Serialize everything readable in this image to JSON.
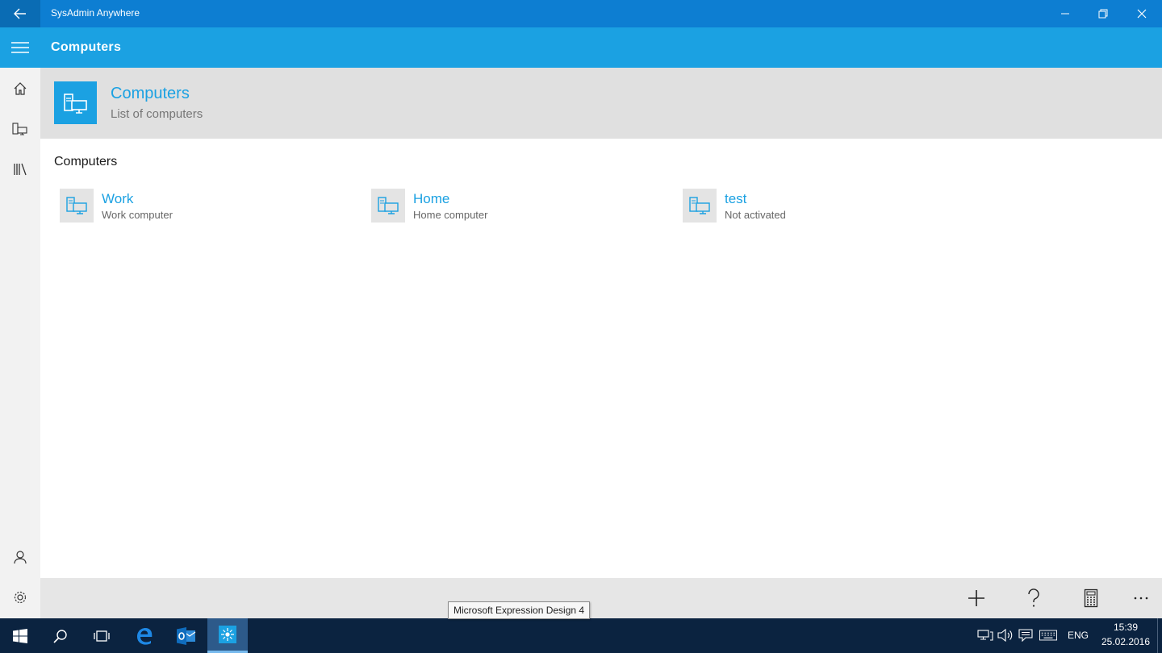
{
  "window": {
    "title": "SysAdmin Anywhere"
  },
  "header": {
    "title": "Computers"
  },
  "banner": {
    "title": "Computers",
    "subtitle": "List of computers"
  },
  "section": {
    "label": "Computers"
  },
  "computers": [
    {
      "name": "Work",
      "description": "Work computer"
    },
    {
      "name": "Home",
      "description": "Home computer"
    },
    {
      "name": "test",
      "description": "Not activated"
    }
  ],
  "tooltip": {
    "text": "Microsoft Expression Design 4"
  },
  "taskbar": {
    "language": "ENG",
    "time": "15:39",
    "date": "25.02.2016"
  },
  "icons": {
    "back": "back-arrow-icon",
    "minimize": "minimize-icon",
    "restore": "restore-icon",
    "close": "close-icon",
    "menu": "hamburger-icon",
    "home": "home-icon",
    "computers": "computer-icon",
    "library": "library-icon",
    "account": "user-icon",
    "settings": "gear-icon",
    "add": "plus-icon",
    "help": "help-icon",
    "calculator": "calculator-icon",
    "more": "more-icon"
  },
  "colors": {
    "titlebar": "#0d7ed2",
    "accent": "#1ba1e2",
    "taskbar": "#0b2340"
  }
}
